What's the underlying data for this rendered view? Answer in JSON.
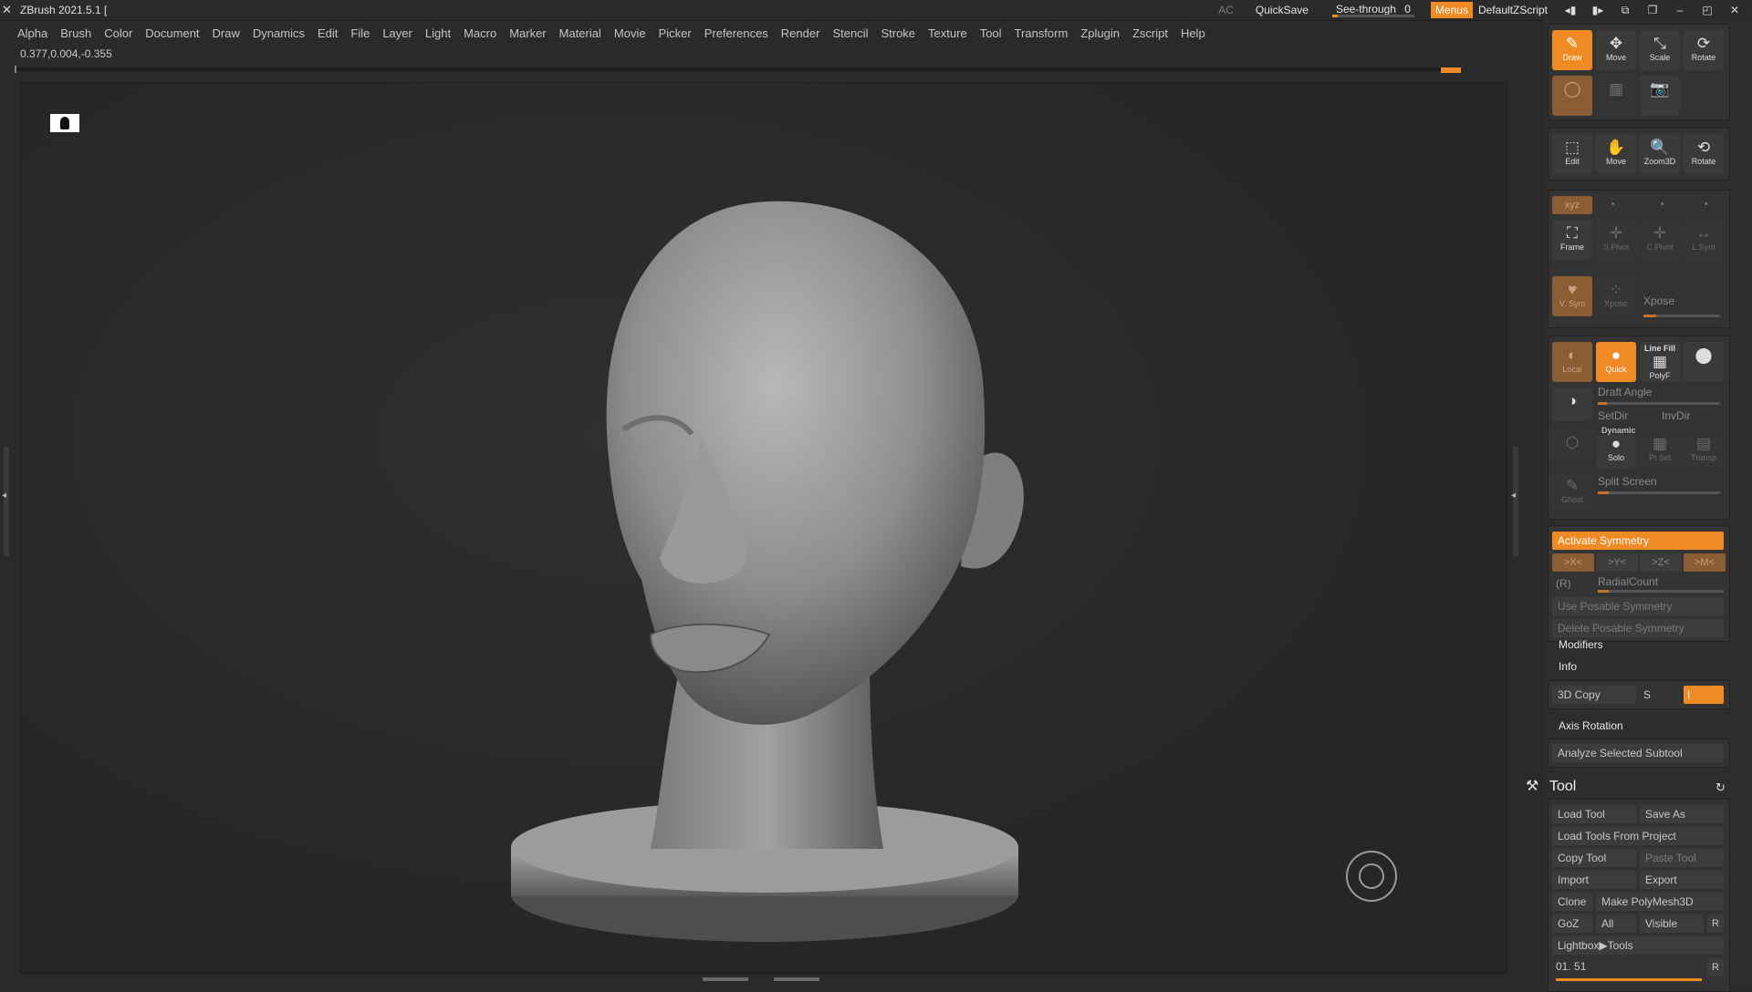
{
  "titlebar": {
    "app_title": "ZBrush 2021.5.1 [",
    "ac": "AC",
    "quicksave": "QuickSave",
    "see_through_label": "See-through",
    "see_through_value": "0",
    "see_through_level": 0.0,
    "menus": "Menus",
    "default_zscript": "DefaultZScript"
  },
  "menubar": {
    "items": [
      "Alpha",
      "Brush",
      "Color",
      "Document",
      "Draw",
      "Dynamics",
      "Edit",
      "File",
      "Layer",
      "Light",
      "Macro",
      "Marker",
      "Material",
      "Movie",
      "Picker",
      "Preferences",
      "Render",
      "Stencil",
      "Stroke",
      "Texture",
      "Tool",
      "Transform",
      "Zplugin",
      "Zscript",
      "Help"
    ]
  },
  "coordinates": "0.377,0.004,-0.355",
  "shelf": {
    "draw_modes": [
      "Draw",
      "Move",
      "Scale",
      "Rotate"
    ],
    "view_tools": [
      "Edit",
      "Move",
      "Zoom3D",
      "Rotate"
    ],
    "axis_labels": [
      "Frame",
      "S.Pivot",
      "C.Pivot",
      "L.Sym"
    ],
    "xyz": "xyz",
    "v_sym": "V. Sym",
    "xpose_small": "Xpose",
    "xpose": "Xpose",
    "local": "Local",
    "quick": "Quick",
    "line_fill": "Line Fill",
    "polyf": "PolyF",
    "draft_angle": "Draft Angle",
    "setdir": "SetDir",
    "invdir": "InvDir",
    "dynamic": "Dynamic",
    "solo": "Solo",
    "pt_sel": "Pt Sel",
    "transp": "Transp",
    "split_screen": "Split Screen",
    "ghost": "Ghost",
    "activate_symmetry": "Activate Symmetry",
    "axes": [
      ">X<",
      ">Y<",
      ">Z<",
      ">M<"
    ],
    "r_label": "(R)",
    "radial_count": "RadialCount",
    "use_posable_symmetry": "Use Posable Symmetry",
    "delete_posable_symmetry": "Delete Posable Symmetry",
    "modifiers": "Modifiers",
    "info": "Info",
    "copy_3d": "3D Copy",
    "s_label": "S",
    "copy_3d_value": "I",
    "axis_rotation": "Axis Rotation",
    "analyze_subtool": "Analyze Selected Subtool"
  },
  "tool": {
    "header": "Tool",
    "load_tool": "Load Tool",
    "save_as": "Save As",
    "load_from_project": "Load Tools From Project",
    "copy_tool": "Copy Tool",
    "paste_tool": "Paste Tool",
    "import": "Import",
    "export": "Export",
    "clone": "Clone",
    "make_polymesh": "Make PolyMesh3D",
    "goz": "GoZ",
    "all": "All",
    "visible": "Visible",
    "r": "R",
    "lightbox_tools": "Lightbox▶Tools",
    "current_tool": "01. 51",
    "r2": "R"
  },
  "colors": {
    "accent": "#f08a24",
    "background": "#2a2a2a"
  },
  "icons": [
    "zbrush-logo-icon",
    "perspective-icon",
    "view-gizmo-icon",
    "draw-icon",
    "move-icon",
    "scale-icon",
    "rotate-icon",
    "camera-icon",
    "tool-hammer-icon",
    "reset-icon"
  ]
}
